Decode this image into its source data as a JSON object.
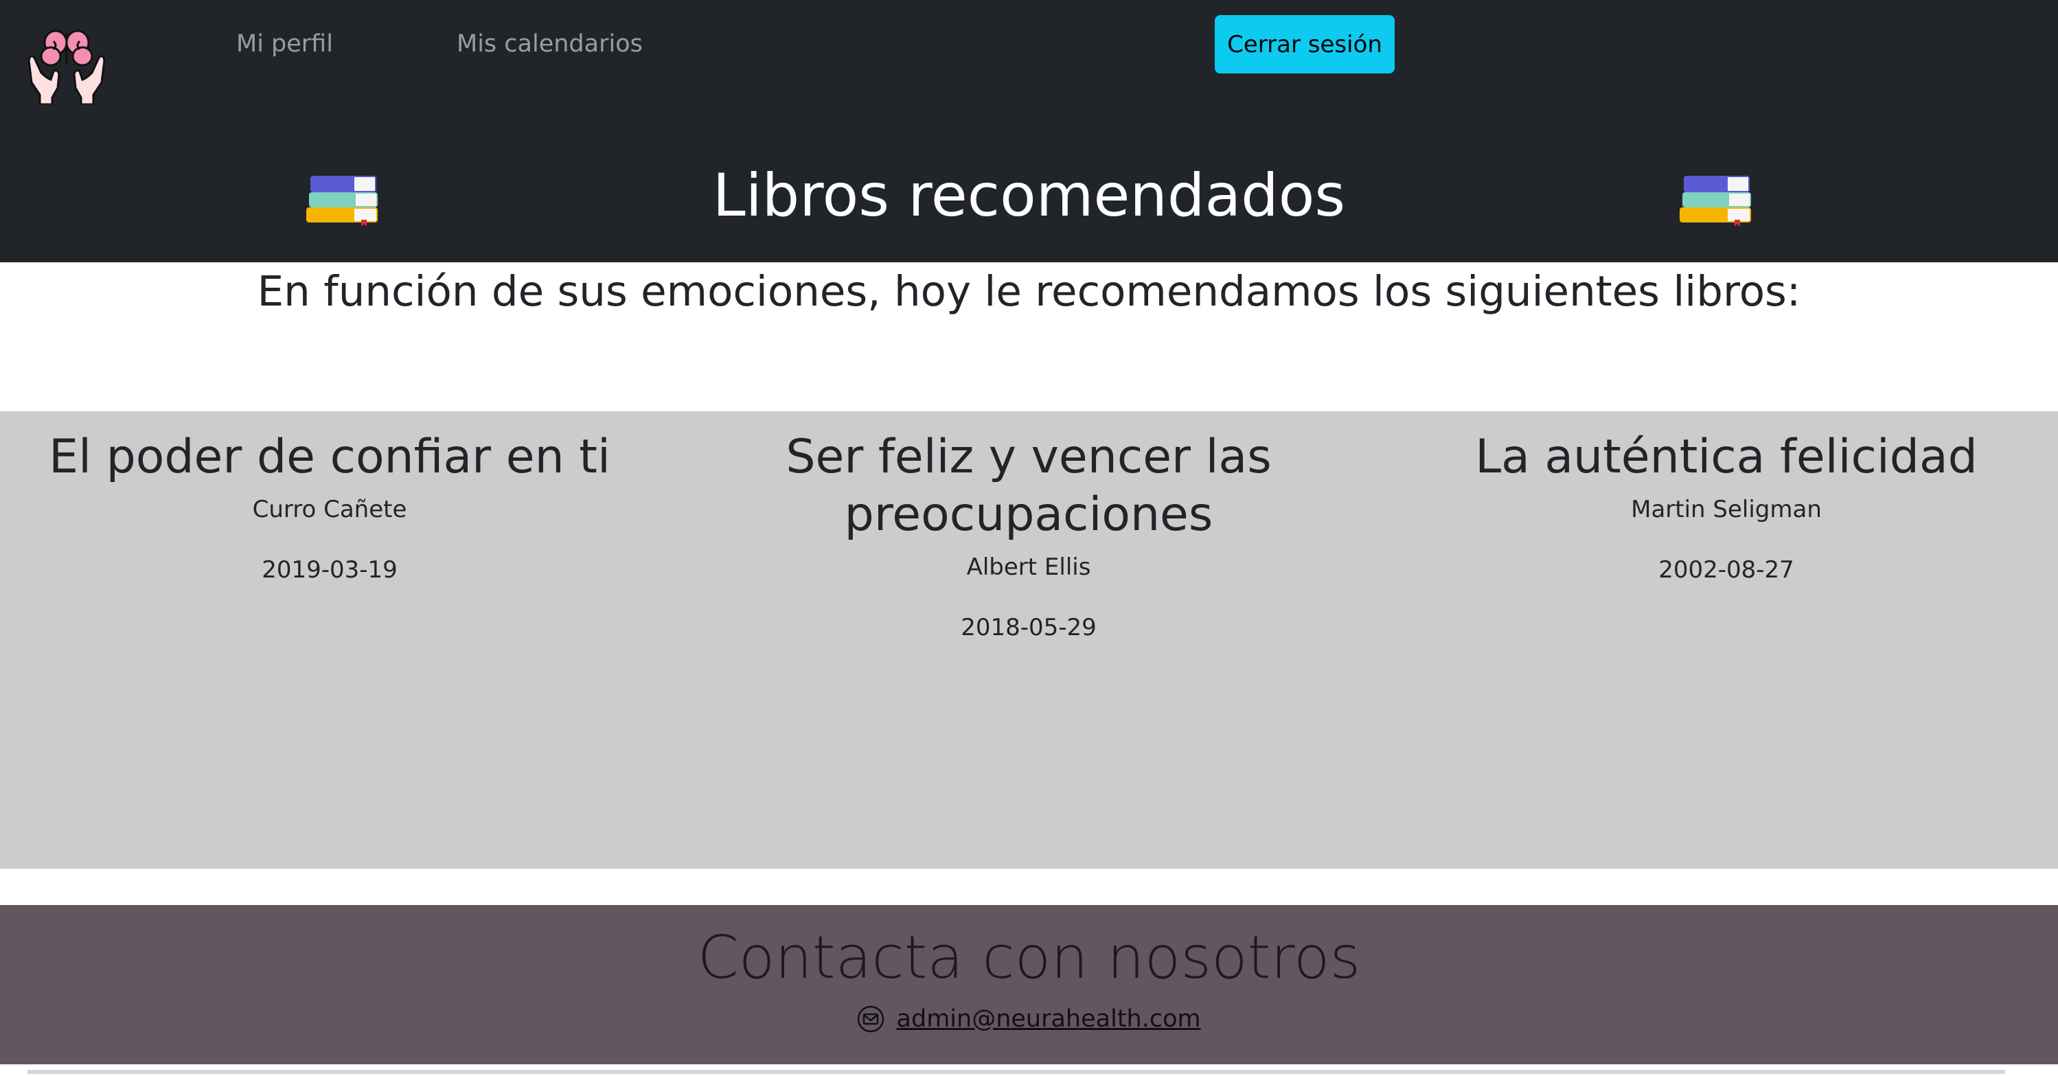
{
  "nav": {
    "logo_icon": "brain-in-hands-icon",
    "links": [
      "Mi perfil",
      "Mis calendarios"
    ],
    "logout_label": "Cerrar sesión",
    "logout_color": "#0dcaf0"
  },
  "header": {
    "title": "Libros recomendados",
    "decor_icon": "books-stack-icon",
    "background": "#212529"
  },
  "intro": "En función de sus emociones, hoy le recomendamos los siguientes libros:",
  "books": [
    {
      "title": "El poder de confiar en ti",
      "author": "Curro Cañete",
      "date": "2019-03-19"
    },
    {
      "title": "Ser feliz y vencer las preocupaciones",
      "author": "Albert Ellis",
      "date": "2018-05-29"
    },
    {
      "title": "La auténtica felicidad",
      "author": "Martin Seligman",
      "date": "2002-08-27"
    }
  ],
  "footer": {
    "title": "Contacta con nosotros",
    "email": "admin@neurahealth.com",
    "email_icon": "envelope-icon",
    "background": "#645660"
  }
}
